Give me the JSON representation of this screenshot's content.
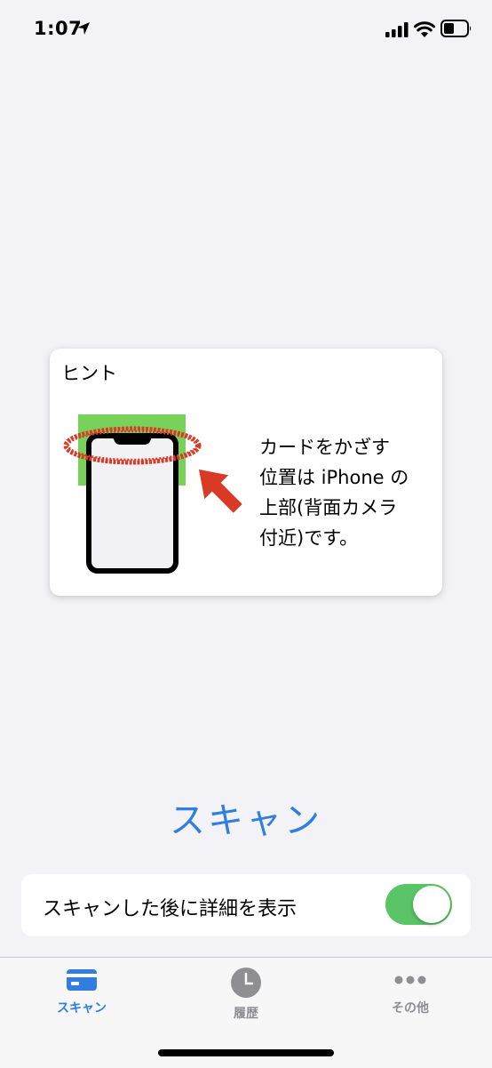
{
  "status_bar": {
    "time": "1:07",
    "icons": [
      "location-arrow-icon",
      "cellular-signal-icon",
      "wifi-icon",
      "battery-icon"
    ]
  },
  "hint": {
    "title": "ヒント",
    "text": "カードをかざす\n位置は iPhone の\n上部(背面カメラ\n付近)です。"
  },
  "scan_button": {
    "label": "スキャン"
  },
  "settings": {
    "show_details_label": "スキャンした後に詳細を表示",
    "show_details_enabled": true
  },
  "tab_bar": {
    "tabs": [
      {
        "label": "スキャン",
        "icon": "card-icon",
        "active": true
      },
      {
        "label": "履歴",
        "icon": "clock-icon",
        "active": false
      },
      {
        "label": "その他",
        "icon": "more-dots-icon",
        "active": false
      }
    ]
  },
  "colors": {
    "accent": "#2f7ee0",
    "toggle_on": "#5ac466",
    "hint_red": "#d93a26",
    "hint_green": "#78d25a",
    "background": "#f2f2f7"
  }
}
